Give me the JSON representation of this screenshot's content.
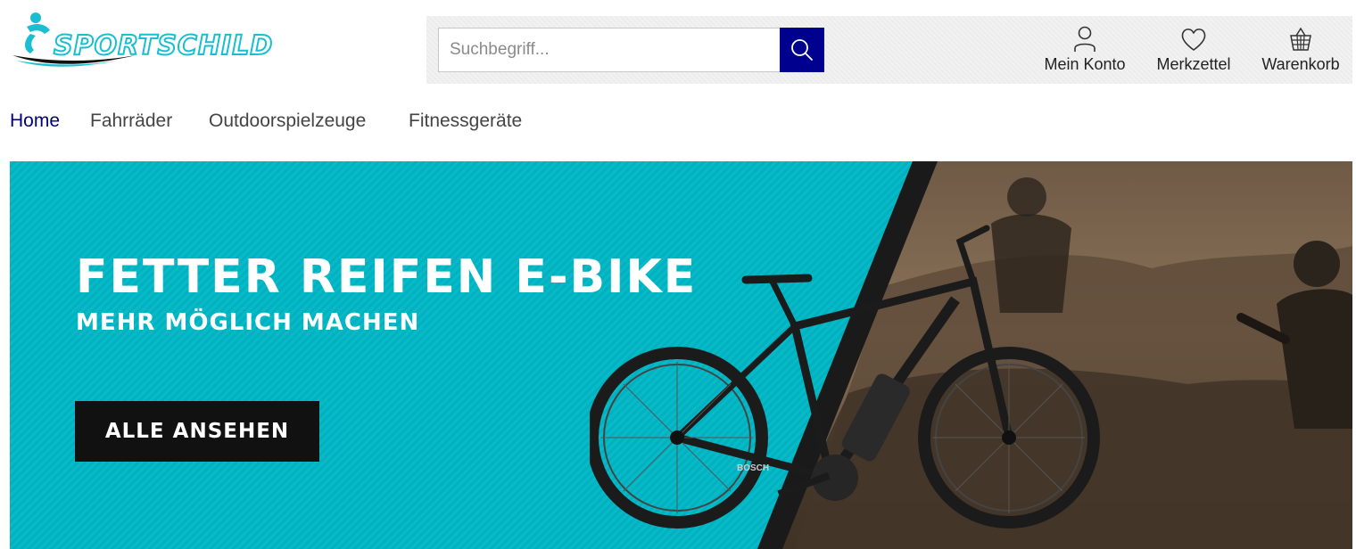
{
  "brand": {
    "name": "SPORTSCHILD",
    "accent": "#19bfd0"
  },
  "search": {
    "placeholder": "Suchbegriff...",
    "button_icon": "search-icon",
    "button_color": "#00008f"
  },
  "account": [
    {
      "label": "Mein Konto",
      "icon": "user-icon"
    },
    {
      "label": "Merkzettel",
      "icon": "heart-icon"
    },
    {
      "label": "Warenkorb",
      "icon": "basket-icon"
    }
  ],
  "nav": {
    "items": [
      {
        "label": "Home",
        "active": true
      },
      {
        "label": "Fahrräder",
        "active": false
      },
      {
        "label": "Outdoorspielzeuge",
        "active": false
      },
      {
        "label": "Fitnessgeräte",
        "active": false
      }
    ],
    "active_color": "#00007a"
  },
  "hero": {
    "title": "FETTER REIFEN E-BIKE",
    "subtitle": "MEHR MÖGLICH MACHEN",
    "cta_label": "ALLE ANSEHEN",
    "background_color": "#00b7c5",
    "bike_brand": "BOSCH"
  }
}
